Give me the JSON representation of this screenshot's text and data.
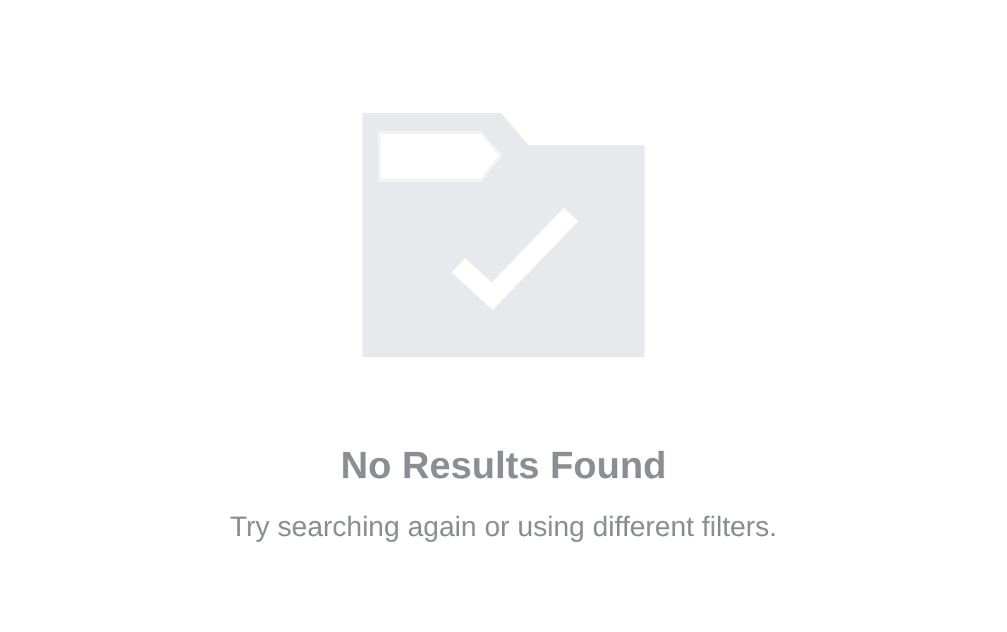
{
  "empty_state": {
    "title": "No Results Found",
    "message": "Try searching again or using different filters."
  }
}
